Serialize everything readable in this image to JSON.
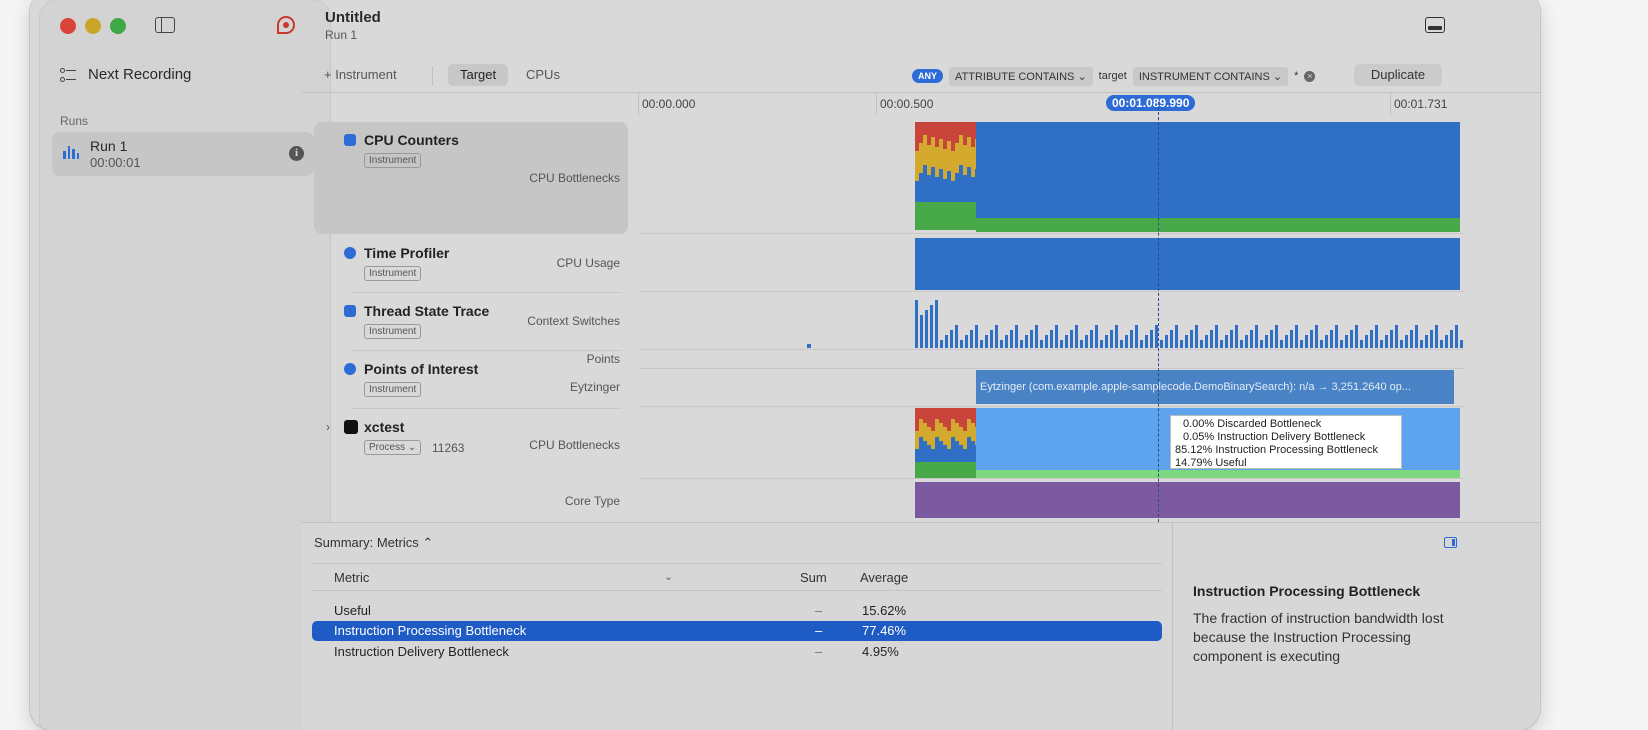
{
  "window": {
    "title": "Untitled",
    "subtitle": "Run 1"
  },
  "sidebar": {
    "next_recording": "Next Recording",
    "runs_label": "Runs",
    "run": {
      "name": "Run 1",
      "duration": "00:00:01"
    }
  },
  "toolbar": {
    "add_instrument": "+ Instrument",
    "tabs": [
      "Target",
      "CPUs"
    ],
    "active_tab": "Target",
    "filter": {
      "any": "ANY",
      "chip1": "ATTRIBUTE CONTAINS ⌄",
      "value1": "target",
      "chip2": "INSTRUMENT CONTAINS ⌄",
      "value2": "*",
      "clear": "×"
    },
    "duplicate": "Duplicate"
  },
  "ruler": {
    "labels": [
      "00:00.000",
      "00:00.500",
      "00:01.731"
    ],
    "playhead": "00:01.089.990"
  },
  "tracks": [
    {
      "name": "CPU Counters",
      "tag": "Instrument",
      "subtitle": "CPU Bottlenecks",
      "icon": "cpu-counters-icon"
    },
    {
      "name": "Time Profiler",
      "tag": "Instrument",
      "subtitle": "CPU Usage",
      "icon": "time-profiler-icon"
    },
    {
      "name": "Thread State Trace",
      "tag": "Instrument",
      "subtitle": "Context Switches",
      "icon": "thread-state-icon"
    },
    {
      "name": "Points of Interest",
      "tag": "Instrument",
      "subtitle_top": "Points",
      "subtitle": "Eytzinger",
      "icon": "poi-icon"
    },
    {
      "name": "xctest",
      "tag": "Process ⌄",
      "pid": "11263",
      "subtitle": "CPU Bottlenecks",
      "subtitle2": "Core Type",
      "icon": "process-icon"
    }
  ],
  "eytzinger_interval": "Eytzinger (com.example.apple-samplecode.DemoBinarySearch): n/a → 3,251.2640 op...",
  "tooltip": [
    "0.00% Discarded Bottleneck",
    "0.05% Instruction Delivery Bottleneck",
    "85.12% Instruction Processing Bottleneck",
    "14.79% Useful"
  ],
  "summary": {
    "selector": "Summary: Metrics ⌃",
    "columns": {
      "metric": "Metric",
      "sum": "Sum",
      "average": "Average"
    },
    "rows": [
      {
        "metric": "Useful",
        "sum": "–",
        "average": "15.62%"
      },
      {
        "metric": "Instruction Processing Bottleneck",
        "sum": "–",
        "average": "77.46%"
      },
      {
        "metric": "Instruction Delivery Bottleneck",
        "sum": "–",
        "average": "4.95%"
      }
    ],
    "selected_row": 1
  },
  "detail": {
    "title": "Instruction Processing Bottleneck",
    "text": "The fraction of instruction bandwidth lost because the Instruction Processing component is executing"
  },
  "colors": {
    "accent": "#2d6bd6",
    "blue": "#2f6fc6",
    "light_blue": "#5ea3ee",
    "green": "#47a84a",
    "light_green": "#7dd77f",
    "yellow": "#d3a92e",
    "red": "#c9443a",
    "purple": "#7b5aa0"
  }
}
